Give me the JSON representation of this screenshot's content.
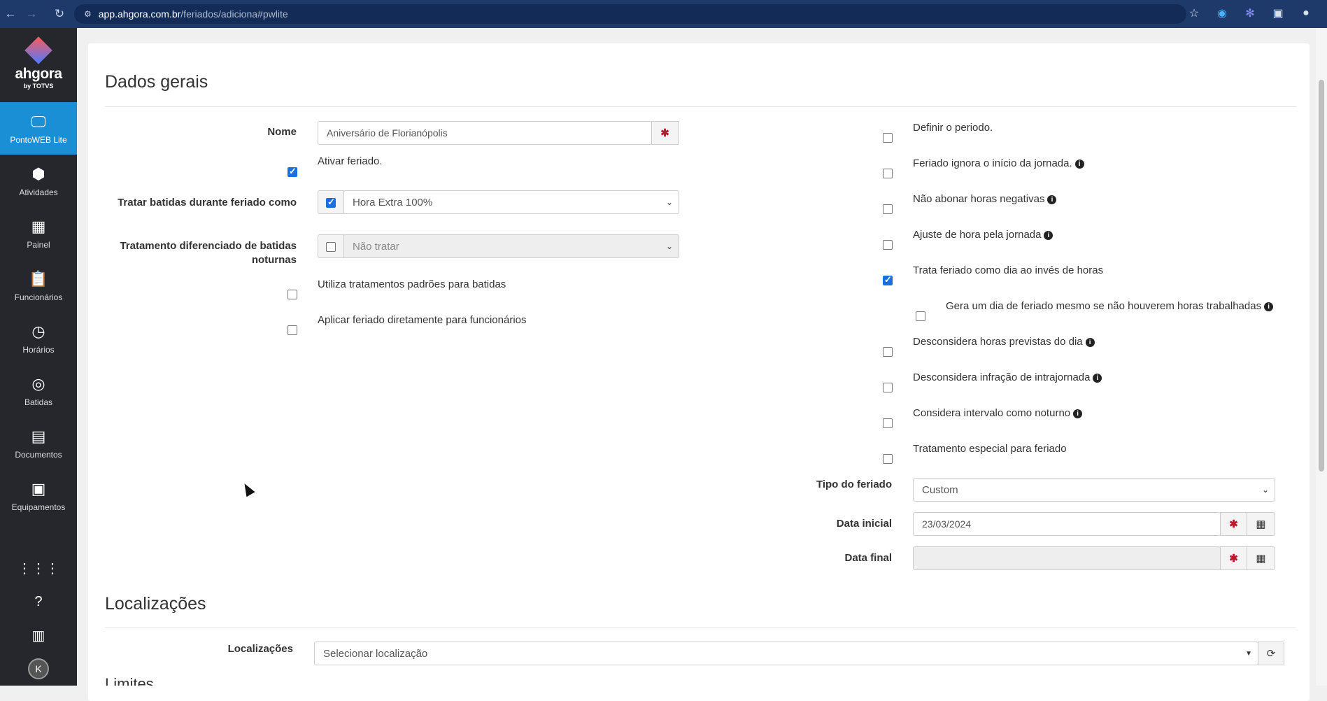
{
  "browser": {
    "url_host": "app.ahgora.com.br",
    "url_path": "/feriados/adiciona#pwlite",
    "icons": [
      "back-icon",
      "forward-icon",
      "reload-icon",
      "site-info-icon",
      "star-icon",
      "grammarly-icon",
      "extension-icon",
      "puzzle-icon",
      "profile-icon"
    ]
  },
  "sidebar": {
    "logo_text": "ahgora",
    "logo_sub": "by TOTVS",
    "items": [
      {
        "label": "PontoWEB Lite",
        "icon": "monitor-icon"
      },
      {
        "label": "Atividades",
        "icon": "cubes-icon"
      },
      {
        "label": "Painel",
        "icon": "dashboard-icon"
      },
      {
        "label": "Funcionários",
        "icon": "clipboard-user-icon"
      },
      {
        "label": "Horários",
        "icon": "clock-icon"
      },
      {
        "label": "Batidas",
        "icon": "fingerprint-icon"
      },
      {
        "label": "Documentos",
        "icon": "document-icon"
      },
      {
        "label": "Equipamentos",
        "icon": "device-icon"
      }
    ],
    "bottom": {
      "avatar_letter": "K"
    }
  },
  "section1": {
    "title": "Dados gerais"
  },
  "left": {
    "nome_label": "Nome",
    "nome_value": "Aniversário de Florianópolis",
    "ativar_label": "Ativar feriado.",
    "tratar_label": "Tratar batidas durante feriado como",
    "tratar_value": "Hora Extra 100%",
    "noturno_label": "Tratamento diferenciado de batidas noturnas",
    "noturno_value": "Não tratar",
    "padroes_label": "Utiliza tratamentos padrões para batidas",
    "aplicar_label": "Aplicar feriado diretamente para funcionários"
  },
  "right": {
    "options": [
      {
        "label": "Definir o periodo.",
        "checked": false,
        "info": false
      },
      {
        "label": "Feriado ignora o início da jornada.",
        "checked": false,
        "info": true
      },
      {
        "label": "Não abonar horas negativas",
        "checked": false,
        "info": true
      },
      {
        "label": "Ajuste de hora pela jornada",
        "checked": false,
        "info": true
      },
      {
        "label": "Trata feriado como dia ao invés de horas",
        "checked": true,
        "info": false
      },
      {
        "label": "Gera um dia de feriado mesmo se não houverem horas trabalhadas",
        "checked": false,
        "info": true
      },
      {
        "label": "Desconsidera horas previstas do dia",
        "checked": false,
        "info": true
      },
      {
        "label": "Desconsidera infração de intrajornada",
        "checked": false,
        "info": true
      },
      {
        "label": "Considera intervalo como noturno",
        "checked": false,
        "info": true
      },
      {
        "label": "Tratamento especial para feriado",
        "checked": false,
        "info": false
      }
    ],
    "tipo_label": "Tipo do feriado",
    "tipo_value": "Custom",
    "data_inicial_label": "Data inicial",
    "data_inicial_value": "23/03/2024",
    "data_final_label": "Data final",
    "data_final_value": ""
  },
  "section2": {
    "title": "Localizações",
    "loc_label": "Localizações",
    "loc_placeholder": "Selecionar localização",
    "next_partial": "Limites"
  }
}
